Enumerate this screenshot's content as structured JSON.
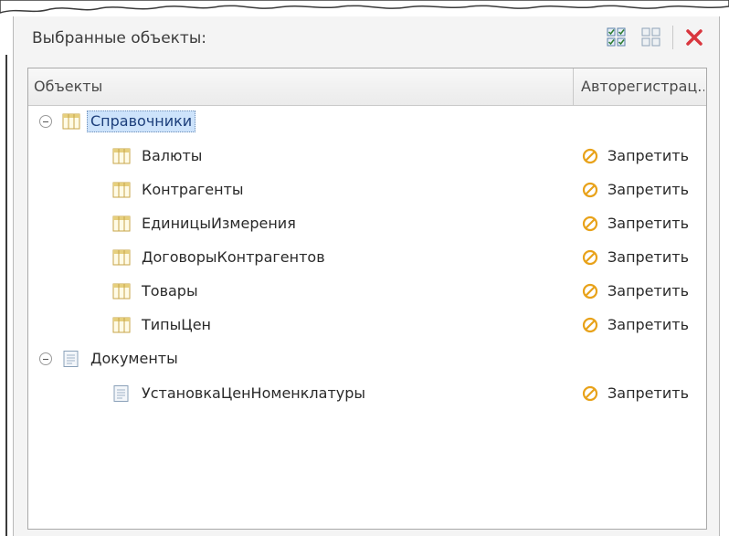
{
  "panel": {
    "title": "Выбранные объекты:",
    "toolbar": [
      {
        "name": "checkbox-grid-icon",
        "kind": "check-all"
      },
      {
        "name": "uncheck-grid-icon",
        "kind": "uncheck-all"
      },
      {
        "name": "close-icon",
        "kind": "delete"
      }
    ]
  },
  "grid": {
    "columns": {
      "objects": "Объекты",
      "autoreg": "Авторегистрац..."
    },
    "groups": [
      {
        "label": "Справочники",
        "icon": "catalog-table-icon",
        "items": [
          {
            "label": "Валюты",
            "autoreg": "Запретить"
          },
          {
            "label": "Контрагенты",
            "autoreg": "Запретить"
          },
          {
            "label": "ЕдиницыИзмерения",
            "autoreg": "Запретить"
          },
          {
            "label": "ДоговорыКонтрагентов",
            "autoreg": "Запретить"
          },
          {
            "label": "Товары",
            "autoreg": "Запретить"
          },
          {
            "label": "ТипыЦен",
            "autoreg": "Запретить"
          }
        ]
      },
      {
        "label": "Документы",
        "icon": "document-icon",
        "items": [
          {
            "label": "УстановкаЦенНоменклатуры",
            "autoreg": "Запретить"
          }
        ]
      }
    ]
  },
  "colors": {
    "selection": "#cde3fb",
    "ban": "#e8a21a",
    "close": "#d9363e",
    "catalog_icon": "#c7a64a"
  }
}
